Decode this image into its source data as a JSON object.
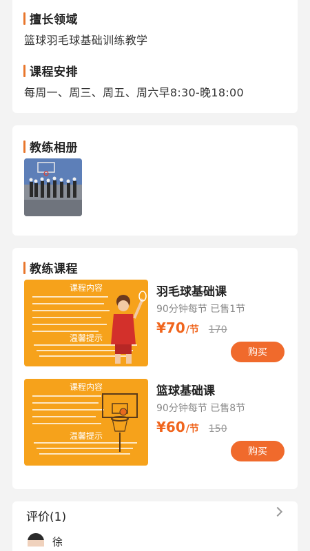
{
  "profile": {
    "specialty_title": "擅长领域",
    "specialty_text": "篮球羽毛球基础训练教学",
    "schedule_title": "课程安排",
    "schedule_text": "每周一、周三、周五、周六早8:30-晚18:00"
  },
  "album": {
    "title": "教练相册"
  },
  "courses": {
    "title": "教练课程",
    "items": [
      {
        "name": "羽毛球基础课",
        "meta": "90分钟每节  已售1节",
        "price": "¥70",
        "unit": "/节",
        "original_price": "170",
        "buy_label": "购买",
        "poster_heading": "课程内容",
        "poster_notice": "温馨提示"
      },
      {
        "name": "篮球基础课",
        "meta": "90分钟每节  已售8节",
        "price": "¥60",
        "unit": "/节",
        "original_price": "150",
        "buy_label": "购买",
        "poster_heading": "课程内容",
        "poster_notice": "温馨提示"
      }
    ]
  },
  "reviews": {
    "title": "评价(1)",
    "first_reviewer": "徐"
  },
  "colors": {
    "accent": "#e8762c",
    "price": "#f0651d",
    "buy_button": "#f06a2c",
    "poster": "#f6a21b"
  }
}
